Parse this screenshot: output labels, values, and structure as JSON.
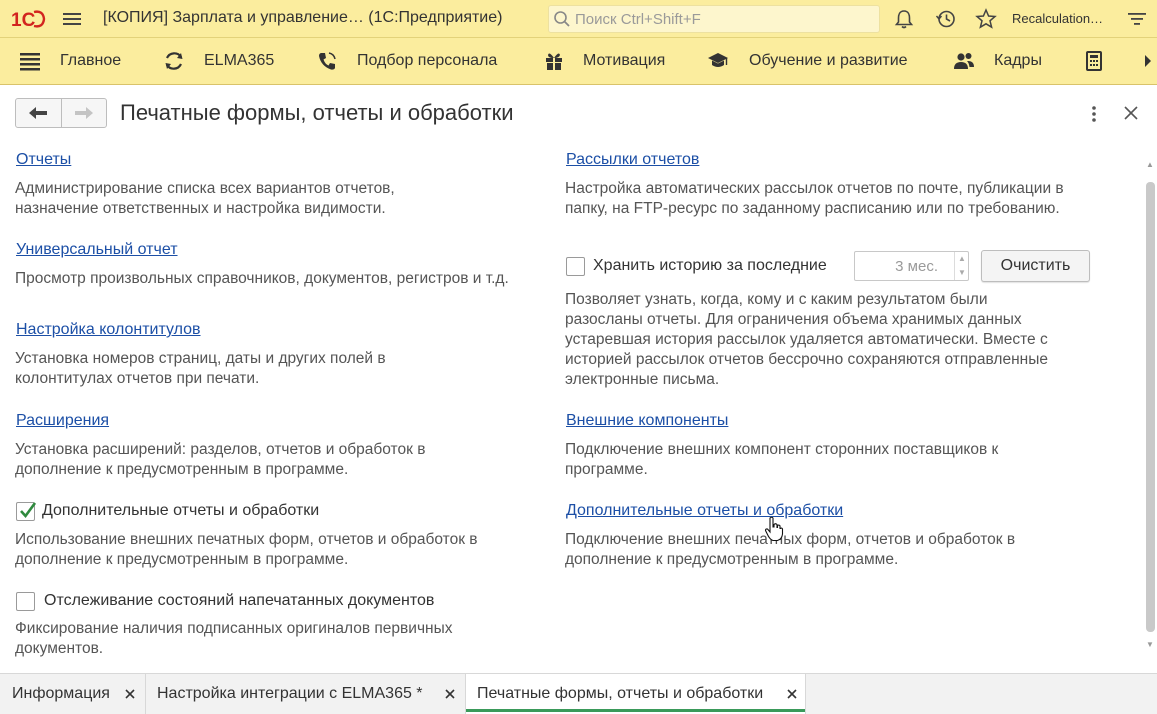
{
  "titlebar": {
    "logo_text": "1С",
    "title": "[КОПИЯ] Зарплата и управление…  (1С:Предприятие)",
    "search_placeholder": "Поиск Ctrl+Shift+F",
    "user": "Recalculation…"
  },
  "sections": [
    {
      "label": "Главное",
      "icon": "menu-icon"
    },
    {
      "label": "ELMA365",
      "icon": "sync-icon"
    },
    {
      "label": "Подбор персонала",
      "icon": "phone-icon"
    },
    {
      "label": "Мотивация",
      "icon": "gift-icon"
    },
    {
      "label": "Обучение и развитие",
      "icon": "graduation-cap-icon"
    },
    {
      "label": "Кадры",
      "icon": "people-icon"
    },
    {
      "label": "",
      "icon": "calculator-icon"
    }
  ],
  "form": {
    "title": "Печатные формы, отчеты и обработки"
  },
  "left": {
    "reports_link": "Отчеты",
    "reports_desc": "Администрирование списка всех вариантов отчетов, назначение ответственных и настройка видимости.",
    "universal_link": "Универсальный отчет",
    "universal_desc": "Просмотр произвольных справочников, документов, регистров и т.д.",
    "headers_link": "Настройка колонтитулов",
    "headers_desc": "Установка номеров страниц, даты и других полей в колонтитулах отчетов при печати.",
    "extensions_link": "Расширения",
    "extensions_desc": "Установка расширений: разделов, отчетов и обработок в дополнение к предусмотренным в программе.",
    "additional_checkbox_label": "Дополнительные отчеты и обработки",
    "additional_checked": true,
    "additional_desc": "Использование внешних печатных форм, отчетов и обработок в дополнение к предусмотренным в программе.",
    "tracking_checkbox_label": "Отслеживание состояний напечатанных документов",
    "tracking_checked": false,
    "tracking_desc": "Фиксирование наличия подписанных оригиналов первичных документов."
  },
  "right": {
    "mailing_link": "Рассылки отчетов",
    "mailing_desc": "Настройка автоматических рассылок отчетов по почте, публикации в папку, на FTP-ресурс по заданному расписанию или по требованию.",
    "history_checkbox_label": "Хранить историю за последние",
    "history_checked": false,
    "history_value": "3 мес.",
    "clear_button": "Очистить",
    "history_desc": "Позволяет узнать, когда, кому и с каким результатом были разосланы отчеты. Для ограничения объема хранимых данных устаревшая история рассылок удаляется автоматически. Вместе с историей рассылок отчетов бессрочно сохраняются отправленные электронные письма.",
    "components_link": "Внешние компоненты",
    "components_desc": "Подключение внешних компонент сторонних поставщиков к программе.",
    "additional_link": "Дополнительные отчеты и обработки",
    "additional_desc": "Подключение внешних печатных форм, отчетов и обработок в дополнение к предусмотренным в программе."
  },
  "tabs": [
    {
      "label": "Информация",
      "active": false
    },
    {
      "label": "Настройка интеграции с ELMA365 *",
      "active": false
    },
    {
      "label": "Печатные формы, отчеты и обработки",
      "active": true
    }
  ],
  "colors": {
    "panel": "#fbed9e",
    "link": "#1c4fa6",
    "active_tab_underline": "#3a9a5a"
  }
}
